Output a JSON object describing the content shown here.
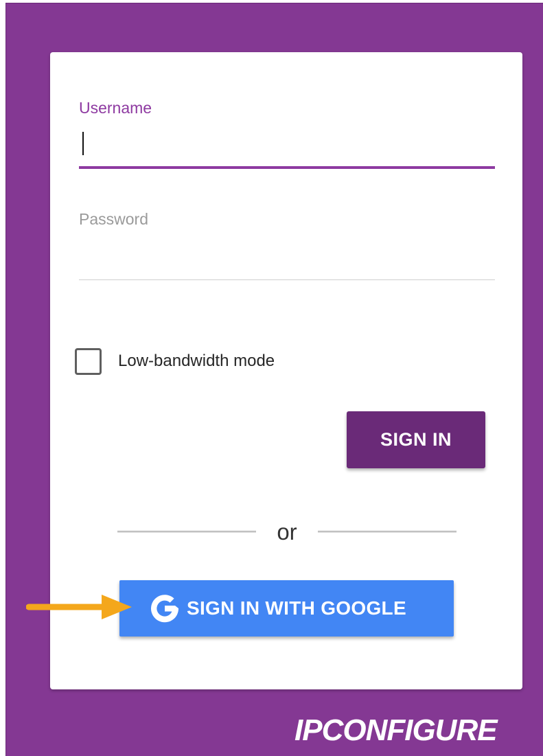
{
  "login": {
    "username_label": "Username",
    "username_value": "",
    "password_label": "Password",
    "password_value": "",
    "low_bandwidth_label": "Low-bandwidth mode",
    "low_bandwidth_checked": false,
    "sign_in_label": "SIGN IN",
    "divider_text": "or",
    "google_label": "SIGN IN WITH GOOGLE"
  },
  "brand": {
    "logo_text": "IPCONFIGURE"
  },
  "icons": {
    "google": "google-g-icon",
    "annotation": "arrow-right-icon"
  },
  "colors": {
    "background": "#843893",
    "accent": "#8e3aa1",
    "sign_in_button": "#6a2a78",
    "google_button": "#4286f4",
    "annotation_arrow": "#f4a71c"
  }
}
